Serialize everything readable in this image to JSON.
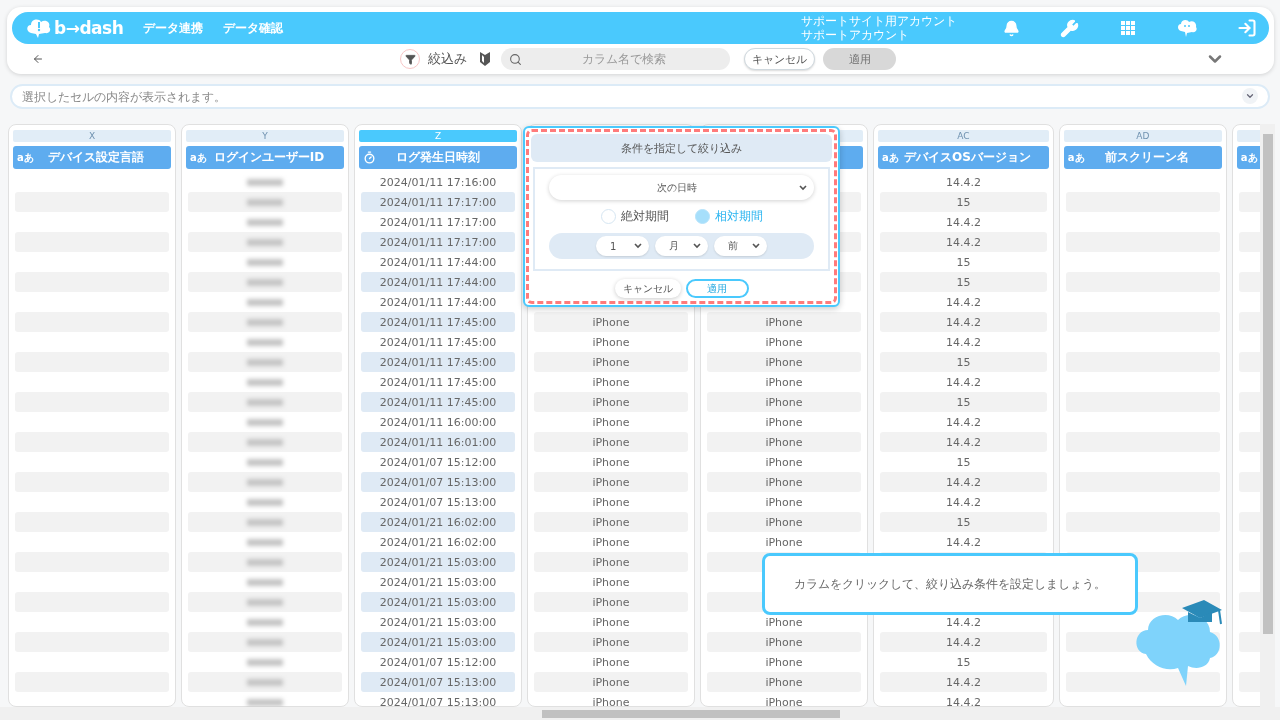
{
  "header": {
    "logo": "b→dash",
    "nav": [
      "データ連携",
      "データ確認"
    ],
    "account": [
      "サポートサイト用アカウント",
      "サポートアカウント"
    ]
  },
  "toolbar": {
    "filter_label": "絞込み",
    "search": {
      "placeholder": "カラム名で検索"
    },
    "cancel": "キャンセル",
    "apply": {
      "label": "適用",
      "disabled": true
    }
  },
  "cell_display": {
    "placeholder": "選択したセルの内容が表示されます。"
  },
  "columns": [
    {
      "letter": "X",
      "title": "デバイス設定言語",
      "kind": "text",
      "type_label": "aあ",
      "selected": false
    },
    {
      "letter": "Y",
      "title": "ログインユーザーID",
      "kind": "redacted",
      "type_label": "aあ",
      "selected": false
    },
    {
      "letter": "Z",
      "title": "ログ発生日時刻",
      "kind": "datetime",
      "selected": true,
      "cells": [
        "2024/01/11 17:16:00",
        "2024/01/11 17:17:00",
        "2024/01/11 17:17:00",
        "2024/01/11 17:17:00",
        "2024/01/11 17:44:00",
        "2024/01/11 17:44:00",
        "2024/01/11 17:44:00",
        "2024/01/11 17:45:00",
        "2024/01/11 17:45:00",
        "2024/01/11 17:45:00",
        "2024/01/11 17:45:00",
        "2024/01/11 17:45:00",
        "2024/01/11 16:00:00",
        "2024/01/11 16:01:00",
        "2024/01/07 15:12:00",
        "2024/01/07 15:13:00",
        "2024/01/07 15:13:00",
        "2024/01/21 16:02:00",
        "2024/01/21 16:02:00",
        "2024/01/21 15:03:00",
        "2024/01/21 15:03:00",
        "2024/01/21 15:03:00",
        "2024/01/21 15:03:00",
        "2024/01/21 15:03:00",
        "2024/01/07 15:12:00",
        "2024/01/07 15:13:00",
        "2024/01/07 15:13:00"
      ]
    },
    {
      "kind": "text",
      "cells": [
        null,
        null,
        null,
        null,
        null,
        null,
        null,
        "iPhone",
        "iPhone",
        "iPhone",
        "iPhone",
        "iPhone",
        "iPhone",
        "iPhone",
        "iPhone",
        "iPhone",
        "iPhone",
        "iPhone",
        "iPhone",
        "iPhone",
        "iPhone",
        "iPhone",
        "iPhone",
        "iPhone",
        "iPhone",
        "iPhone",
        "iPhone"
      ]
    },
    {
      "kind": "text",
      "selected": false,
      "cells": [
        null,
        null,
        null,
        null,
        null,
        null,
        null,
        "iPhone",
        "iPhone",
        "iPhone",
        "iPhone",
        "iPhone",
        "iPhone",
        "iPhone",
        "iPhone",
        "iPhone",
        "iPhone",
        "iPhone",
        "iPhone",
        null,
        null,
        null,
        "iPhone",
        "iPhone",
        "iPhone",
        "iPhone",
        "iPhone"
      ]
    },
    {
      "letter": "AC",
      "title": "デバイスOSバージョン",
      "kind": "text",
      "type_label": "aあ",
      "selected": false,
      "cells": [
        "14.4.2",
        "15",
        "14.4.2",
        "14.4.2",
        "15",
        "15",
        "14.4.2",
        "14.4.2",
        "14.4.2",
        "15",
        "14.4.2",
        "15",
        "14.4.2",
        "14.4.2",
        "15",
        "14.4.2",
        "14.4.2",
        "15",
        "14.4.2",
        null,
        null,
        null,
        "14.4.2",
        "14.4.2",
        "15",
        "14.4.2",
        "14.4.2"
      ]
    },
    {
      "letter": "AD",
      "title": "前スクリーン名",
      "kind": "text",
      "type_label": "aあ",
      "selected": false
    },
    {
      "kind": "text",
      "type_label": "aあ",
      "selected": false
    }
  ],
  "filter_popup": {
    "title": "条件を指定して絞り込み",
    "condition": "次の日時",
    "options": [
      {
        "label": "絶対期間",
        "selected": false
      },
      {
        "label": "相対期間",
        "selected": true
      }
    ],
    "period": [
      "1",
      "月",
      "前"
    ],
    "cancel": "キャンセル",
    "apply": "適用"
  },
  "hint": {
    "text": "カラムをクリックして、絞り込み条件を設定しましょう。"
  }
}
